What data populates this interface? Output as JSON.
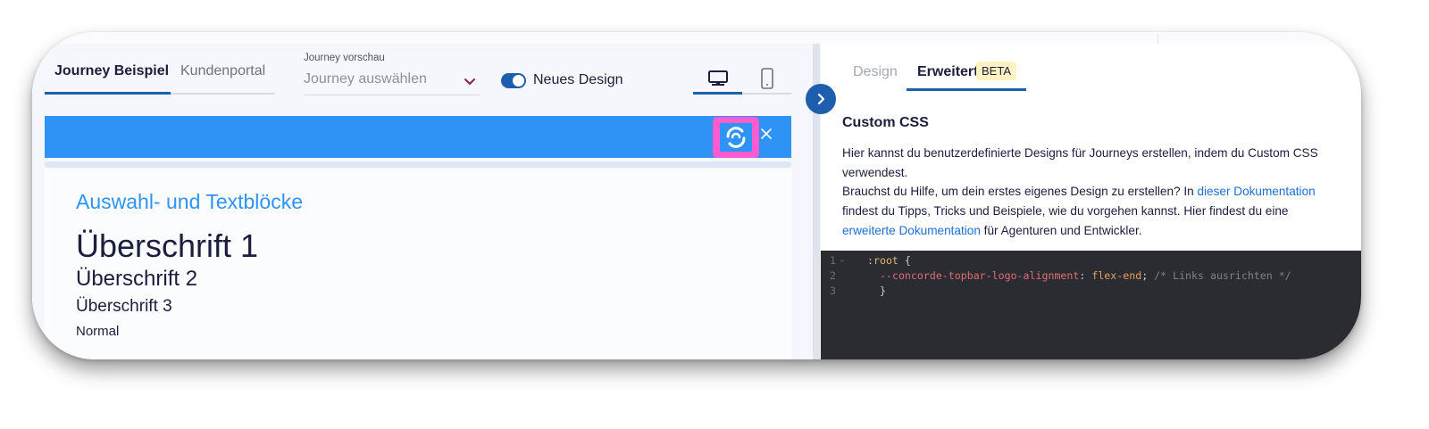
{
  "left_tabs": [
    {
      "label": "Journey Beispiel",
      "active": true
    },
    {
      "label": "Kundenportal",
      "active": false
    }
  ],
  "journey_select": {
    "label": "Journey vorschau",
    "placeholder": "Journey auswählen"
  },
  "toggle": {
    "label": "Neues Design",
    "on": true
  },
  "device_buttons": [
    {
      "icon": "desktop-icon",
      "active": true
    },
    {
      "icon": "mobile-icon",
      "active": false
    }
  ],
  "preview": {
    "section_title": "Auswahl- und Textblöcke",
    "h1": "Überschrift 1",
    "h2": "Überschrift 2",
    "h3": "Überschrift 3",
    "normal": "Normal",
    "bar_color": "#2f93f6",
    "logo_highlight_color": "#ff5cd1",
    "close_symbol": "×"
  },
  "right_tabs": [
    {
      "label": "Design",
      "active": false
    },
    {
      "label": "Erweitert",
      "active": true,
      "badge": "BETA"
    }
  ],
  "custom_css": {
    "title": "Custom CSS",
    "p1": "Hier kannst du benutzerdefinierte Designs für Journeys erstellen, indem du Custom CSS verwendest.",
    "p2_before": "Brauchst du Hilfe, um dein erstes eigenes Design zu erstellen? In ",
    "p2_link": "dieser Dokumentation",
    "p2_after": " findest du Tipps, Tricks und Beispiele, wie du vorgehen kannst. Hier findest du eine ",
    "p2_link2": "erweiterte Dokumentation",
    "p2_end": " für Agenturen und Entwickler."
  },
  "editor": {
    "lines": [
      {
        "num": "1",
        "fold": "⌄",
        "selector": ":root",
        "brace": " {"
      },
      {
        "num": "2",
        "prop": "--concorde-topbar-logo-alignment",
        "colon": ": ",
        "value": "flex-end",
        "semi": ";",
        "comment": " /* Links ausrichten */"
      },
      {
        "num": "3",
        "close": "}"
      }
    ]
  },
  "colors": {
    "accent": "#1d5eae",
    "link": "#1d6fd6",
    "editor_bg": "#2a2c32"
  }
}
